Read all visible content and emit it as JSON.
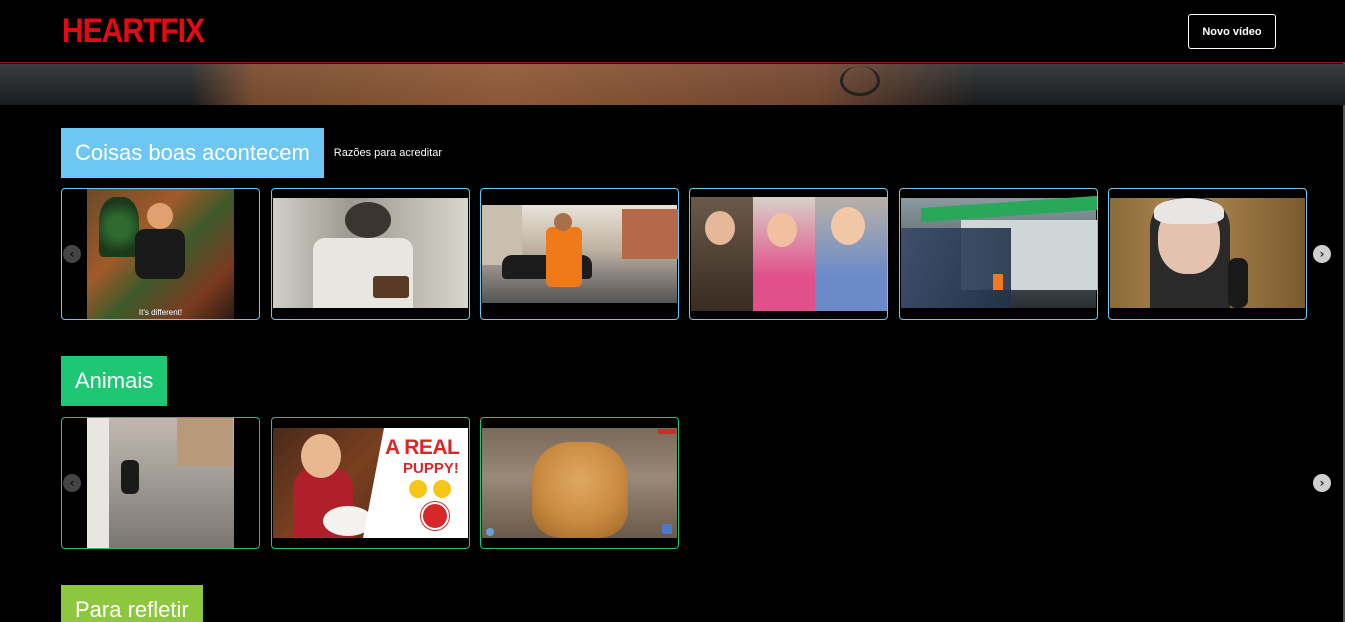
{
  "brand": {
    "logo_text": "HEARTFIX",
    "logo_color": "#e50914"
  },
  "header": {
    "new_video_label": "Novo vídeo"
  },
  "sections": [
    {
      "title": "Coisas boas acontecem",
      "subtitle": "Razões para acreditar",
      "accent": "#6ec6f2",
      "thumbnails": [
        {
          "caption": "It's different!"
        },
        {
          "caption": ""
        },
        {
          "caption": ""
        },
        {
          "caption": ""
        },
        {
          "caption": ""
        },
        {
          "caption": ""
        }
      ]
    },
    {
      "title": "Animais",
      "subtitle": "",
      "accent": "#1ec773",
      "thumbnails": [
        {
          "caption": ""
        },
        {
          "caption": "A REAL",
          "caption2": "PUPPY!"
        },
        {
          "caption": ""
        }
      ]
    },
    {
      "title": "Para refletir",
      "subtitle": "",
      "accent": "#8dc63f"
    }
  ],
  "icons": {
    "prev": "chevron-left-icon",
    "next": "chevron-right-icon"
  }
}
